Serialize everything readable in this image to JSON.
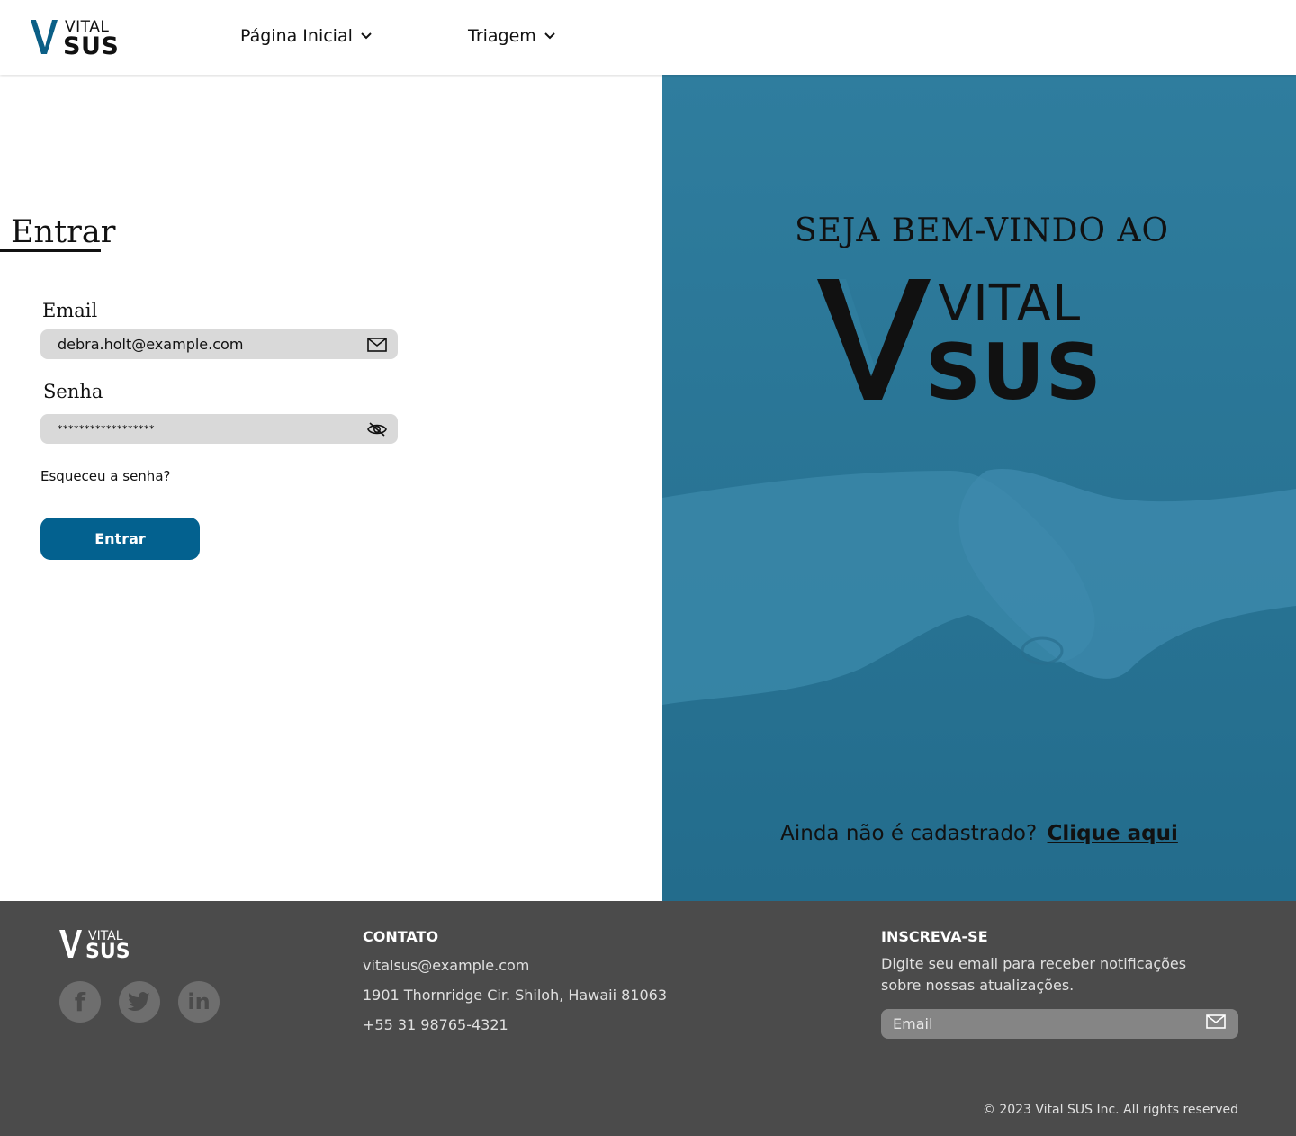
{
  "brand": {
    "logo_top": "VITAL",
    "logo_bottom": "SUS",
    "colors": {
      "primary": "#03618f",
      "logo_v": "#0b5f86",
      "panel": "#2f7d9e",
      "footer_bg": "#4b4b4b",
      "field_bg": "#d9d9d9"
    }
  },
  "header": {
    "nav": [
      {
        "label": "Página Inicial",
        "icon": "chevron-down-icon"
      },
      {
        "label": "Triagem",
        "icon": "chevron-down-icon"
      }
    ]
  },
  "login": {
    "title": "Entrar",
    "email_label": "Email",
    "email_value": "debra.holt@example.com",
    "email_icon": "mail-icon",
    "password_label": "Senha",
    "password_value": "******************",
    "password_icon": "eye-off-icon",
    "forgot_link": "Esqueceu a senha?",
    "submit_label": "Entrar"
  },
  "welcome": {
    "title": "SEJA BEM-VINDO AO",
    "signup_prompt": "Ainda não é cadastrado?",
    "signup_link": "Clique aqui"
  },
  "footer": {
    "social": [
      {
        "name": "facebook-icon",
        "glyph": "f"
      },
      {
        "name": "twitter-icon",
        "glyph": "t"
      },
      {
        "name": "linkedin-icon",
        "glyph": "in"
      }
    ],
    "contact": {
      "heading": "CONTATO",
      "email": "vitalsus@example.com",
      "address": "1901 Thornridge Cir. Shiloh, Hawaii 81063",
      "phone": "+55 31 98765-4321"
    },
    "subscribe": {
      "heading": "INSCREVA-SE",
      "description": "Digite seu email para receber notificações sobre nossas atualizações.",
      "placeholder": "Email",
      "icon": "mail-icon"
    },
    "copyright": "© 2023 Vital SUS Inc. All rights reserved"
  }
}
